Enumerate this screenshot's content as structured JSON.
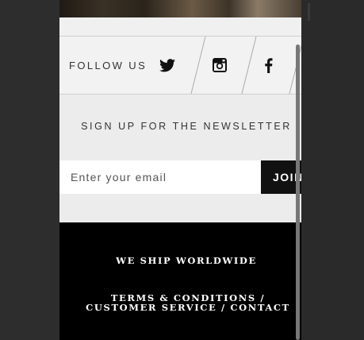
{
  "follow": {
    "label": "FOLLOW US",
    "icons": [
      "twitter-icon",
      "instagram-icon",
      "facebook-icon"
    ]
  },
  "newsletter": {
    "title": "SIGN UP FOR THE NEWSLETTER",
    "email_placeholder": "Enter your email",
    "email_value": "",
    "join_label": "JOIN"
  },
  "footer": {
    "shipping": "WE SHIP WORLDWIDE",
    "links": [
      {
        "label": "TERMS & CONDITIONS"
      },
      {
        "label": "CUSTOMER SERVICE"
      },
      {
        "label": "CONTACT"
      }
    ],
    "separator": "/"
  },
  "colors": {
    "background": "#2b2b2b",
    "page": "#ececec",
    "footer": "#000000",
    "button": "#111111"
  }
}
